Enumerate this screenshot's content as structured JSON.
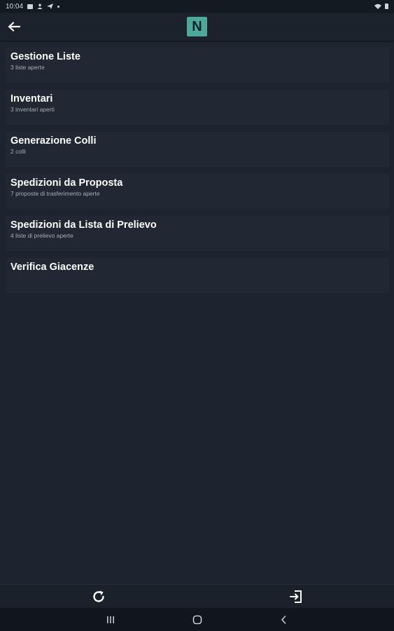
{
  "status_bar": {
    "time": "10:04"
  },
  "app_bar": {
    "logo_letter": "N",
    "back_icon": "arrow-left-icon"
  },
  "menu": {
    "items": [
      {
        "title": "Gestione Liste",
        "subtitle": "3 liste aperte"
      },
      {
        "title": "Inventari",
        "subtitle": "3 inventari aperti"
      },
      {
        "title": "Generazione Colli",
        "subtitle": "2 colli"
      },
      {
        "title": "Spedizioni da Proposta",
        "subtitle": "7 proposte di trasferimento aperte"
      },
      {
        "title": "Spedizioni da Lista di Prelievo",
        "subtitle": "4 liste di prelievo aperte"
      },
      {
        "title": "Verifica Giacenze",
        "subtitle": ""
      }
    ]
  },
  "toolbar": {
    "refresh_icon": "refresh-icon",
    "logout_icon": "logout-icon"
  },
  "colors": {
    "background": "#1d2430",
    "card": "#212833",
    "accent": "#4aa99a"
  }
}
